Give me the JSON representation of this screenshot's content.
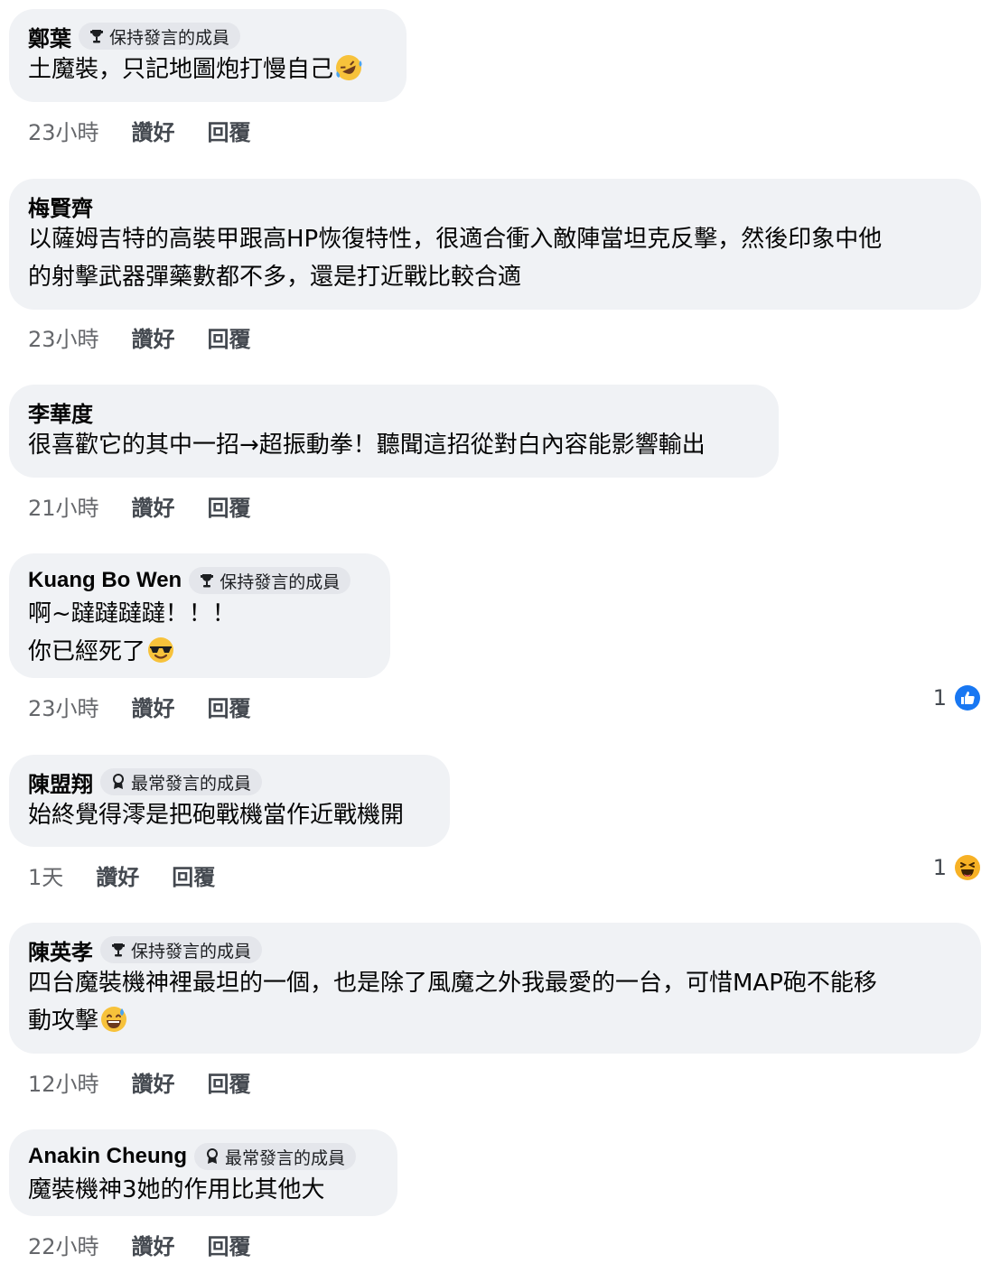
{
  "actions": {
    "like": "讚好",
    "reply": "回覆"
  },
  "comments": [
    {
      "author": "鄭葉",
      "badge": "保持發言的成員",
      "lines": [
        "土魔裝，只記地圖炮打慢自己"
      ],
      "emoji": "rolling-laughing-emoji",
      "time": "23小時"
    },
    {
      "author": "梅賢齊",
      "lines": [
        "以薩姆吉特的高裝甲跟高HP恢復特性，很適合衝入敵陣當坦克反擊，然後印象中他",
        "的射擊武器彈藥數都不多，還是打近戰比較合適"
      ],
      "time": "23小時"
    },
    {
      "author": "李華度",
      "lines": [
        "很喜歡它的其中一招→超振動拳！聽聞這招從對白內容能影響輸出"
      ],
      "time": "21小時"
    },
    {
      "author": "Kuang Bo Wen",
      "badge": "保持發言的成員",
      "lines": [
        "啊~躂躂躂躂！！！",
        "你已經死了"
      ],
      "emoji": "sunglasses-emoji",
      "time": "23小時",
      "reaction": {
        "count": "1",
        "icon": "like-reaction-icon"
      }
    },
    {
      "author": "陳盟翔",
      "badge": "最常發言的成員",
      "lines": [
        "始終覺得澪是把砲戰機當作近戰機開"
      ],
      "time": "1天",
      "reaction": {
        "count": "1",
        "icon": "haha-reaction-icon"
      }
    },
    {
      "author": "陳英孝",
      "badge": "保持發言的成員",
      "lines": [
        "四台魔裝機神裡最坦的一個，也是除了風魔之外我最愛的一台，可惜MAP砲不能移",
        "動攻擊"
      ],
      "emoji": "sweat-smile-emoji",
      "time": "12小時"
    },
    {
      "author": "Anakin Cheung",
      "badge": "最常發言的成員",
      "lines": [
        "魔裝機神3她的作用比其他大"
      ],
      "time": "22小時"
    }
  ]
}
